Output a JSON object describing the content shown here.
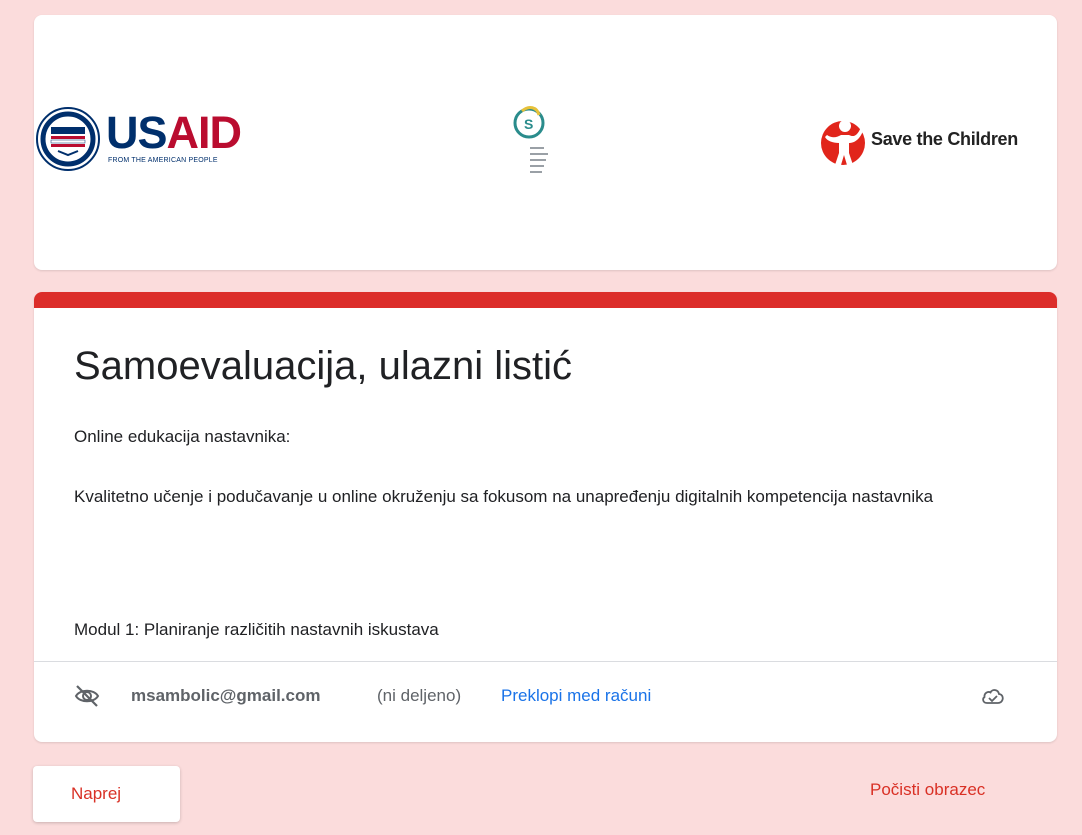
{
  "banner": {
    "usaid_word_us": "US",
    "usaid_word_aid": "AID",
    "usaid_tagline": "FROM THE AMERICAN PEOPLE",
    "stc_name": "Save the Children"
  },
  "form": {
    "title": "Samoevaluacija, ulazni listić",
    "description_line1": "Online edukacija nastavnika:",
    "description_line2": "Kvalitetno učenje i podučavanje u online okruženju sa fokusom na unapređenju digitalnih kompetencija nastavnika",
    "description_line3": "Modul 1: Planiranje različitih nastavnih iskustava"
  },
  "account": {
    "email": "msambolic@gmail.com",
    "shared_note": "(ni deljeno)",
    "switch_label": "Preklopi med računi"
  },
  "actions": {
    "next_label": "Naprej",
    "clear_label": "Počisti obrazec"
  },
  "colors": {
    "background": "#fbdcdc",
    "accent": "#dc2d2a",
    "link": "#1a73e8",
    "action_text": "#d93025"
  }
}
